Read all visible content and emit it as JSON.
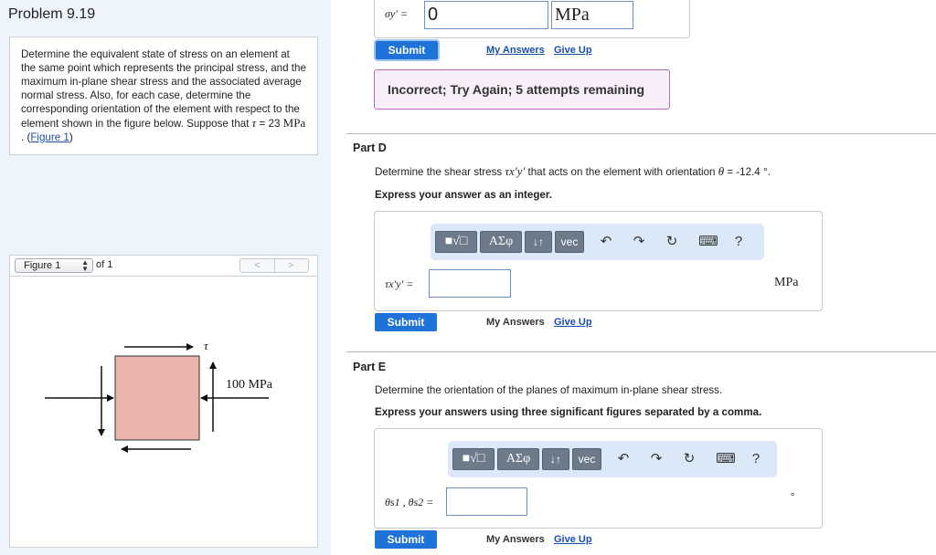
{
  "problem": {
    "title": "Problem 9.19",
    "text": "Determine the equivalent state of stress on an element at the same point which represents the principal stress, and the maximum in-plane shear stress and the associated average normal stress. Also, for each case, determine the corresponding orientation of the element with respect to the element shown in the figure below. Suppose that",
    "tau_symbol": "τ",
    "tau_eq": " = 23 ",
    "tau_unit": "MPa",
    "dot": " . (",
    "figure_link": "Figure 1",
    "close_paren": ")"
  },
  "figure_panel": {
    "selected": "Figure 1",
    "of_text": "of 1",
    "prev": "<",
    "next": ">",
    "tau_label": "τ",
    "stress_label": "100 MPa",
    "element_color": "#e9b4ab"
  },
  "part_c_tail": {
    "var_label": "σy′ =",
    "input_value": "0",
    "unit_value": "MPa",
    "submit": "Submit",
    "my_answers": "My Answers",
    "give_up": "Give Up",
    "feedback": "Incorrect; Try Again; 5 attempts remaining",
    "feedback_color": "#b86cb7"
  },
  "part_d": {
    "title": "Part D",
    "question_pre": "Determine the shear stress ",
    "question_sym": "τx′y′",
    "question_mid": " that acts on the element with orientation ",
    "question_theta": "θ",
    "question_post": " = -12.4 °.",
    "instruction": "Express your answer as an integer.",
    "var_label": "τx′y′ =",
    "input_value": "",
    "unit": "MPa",
    "submit": "Submit",
    "my_answers": "My Answers",
    "give_up": "Give Up"
  },
  "part_e": {
    "title": "Part E",
    "question": "Determine the orientation of the planes of maximum in-plane shear stress.",
    "instruction": "Express your answers using three significant figures separated by a comma.",
    "var_label": "θs1 , θs2 =",
    "input_value": "",
    "unit": "°",
    "submit": "Submit",
    "my_answers": "My Answers",
    "give_up": "Give Up"
  },
  "toolbar": {
    "templates": "■√□",
    "greek": "ΑΣφ",
    "arrows": "↓↑",
    "vec": "vec",
    "undo_icon": "undo-icon",
    "redo_icon": "redo-icon",
    "reset_icon": "reset-icon",
    "keyboard_icon": "keyboard-icon",
    "help": "?"
  },
  "colors": {
    "accent": "#1e72d8",
    "panel_bg": "#eef4fb",
    "toolbar_bg": "#dbe8f8"
  }
}
